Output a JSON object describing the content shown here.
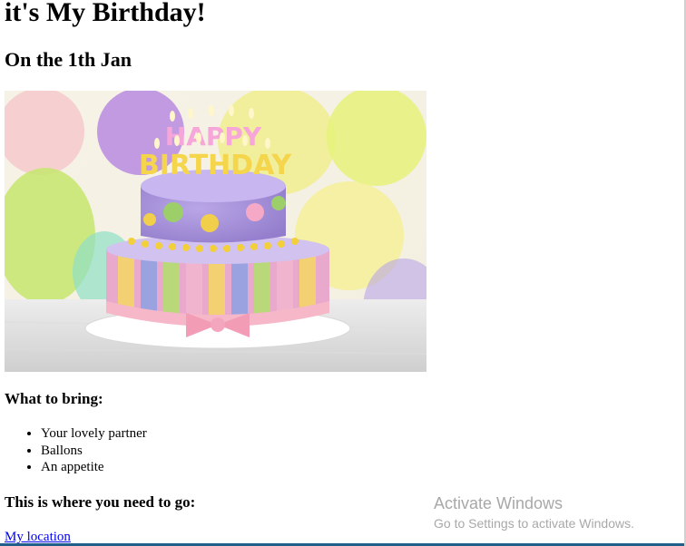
{
  "page": {
    "title": "it's My Birthday!",
    "subtitle": "On the 1th Jan"
  },
  "image": {
    "cake_text": "HAPPY BIRTHDAY"
  },
  "bring": {
    "heading": "What to bring:",
    "items": [
      "Your lovely partner",
      "Ballons",
      "An appetite"
    ]
  },
  "location": {
    "heading": "This is where you need to go:",
    "link_label": "My location"
  },
  "watermark": {
    "title": "Activate Windows",
    "subtitle": "Go to Settings to activate Windows."
  },
  "colors": {
    "link": "#0000ee",
    "watermark": "#a8a8a8"
  }
}
